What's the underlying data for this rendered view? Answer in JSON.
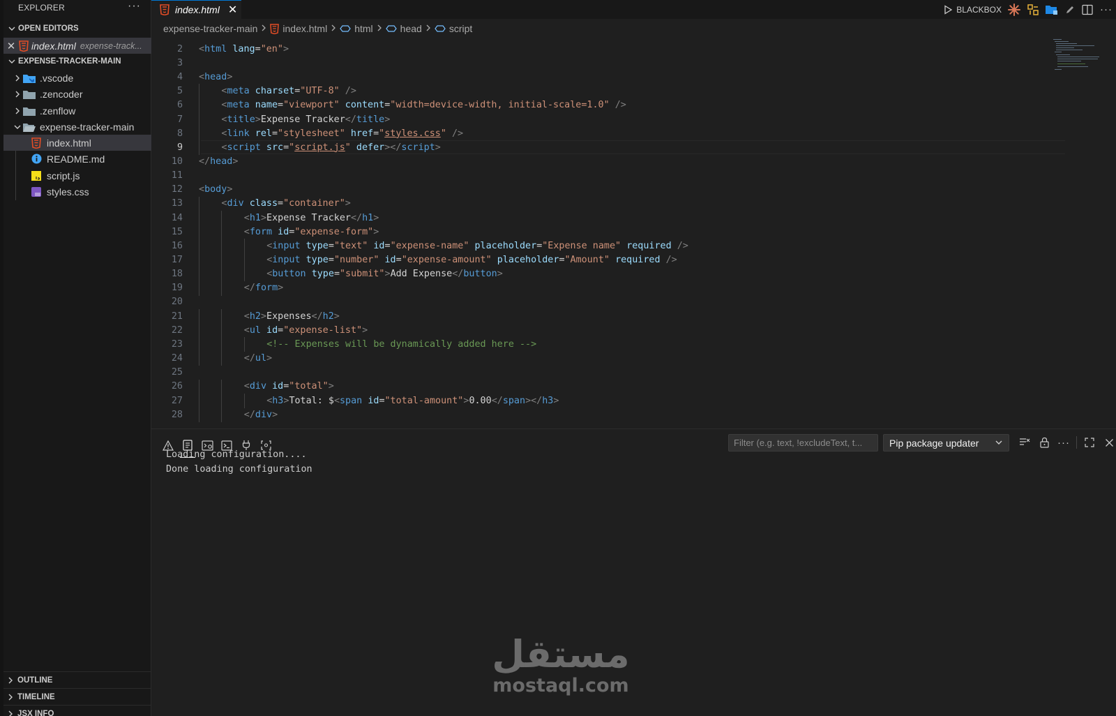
{
  "colors": {
    "html_icon": "#e44d26",
    "accent": "#0078d4",
    "folder_vscode": "#42a5f5",
    "folder_default": "#90a4ae",
    "readme_icon": "#42a5f5",
    "js_icon": "#f5de19",
    "css_icon": "#7e57c2"
  },
  "sidebar": {
    "title": "EXPLORER",
    "more": "···",
    "open_editors": {
      "label": "OPEN EDITORS",
      "item": {
        "name": "index.html",
        "description": "expense-track..."
      }
    },
    "project": {
      "label": "EXPENSE-TRACKER-MAIN",
      "items": [
        {
          "label": ".vscode",
          "icon": "vscode-folder-icon",
          "kind": "folder",
          "expanded": false
        },
        {
          "label": ".zencoder",
          "icon": "folder-icon",
          "kind": "folder",
          "expanded": false
        },
        {
          "label": ".zenflow",
          "icon": "folder-icon",
          "kind": "folder",
          "expanded": false
        },
        {
          "label": "expense-tracker-main",
          "icon": "folder-open-icon",
          "kind": "folder",
          "expanded": true
        },
        {
          "label": "index.html",
          "icon": "html-file-icon",
          "kind": "file",
          "selected": true
        },
        {
          "label": "README.md",
          "icon": "info-file-icon",
          "kind": "file"
        },
        {
          "label": "script.js",
          "icon": "js-file-icon",
          "kind": "file"
        },
        {
          "label": "styles.css",
          "icon": "css-file-icon",
          "kind": "file"
        }
      ]
    },
    "bottom_sections": [
      "OUTLINE",
      "TIMELINE",
      "JSX INFO"
    ]
  },
  "tabs": [
    {
      "label": "index.html",
      "icon": "html-file-icon",
      "active": true
    }
  ],
  "title_actions": {
    "blackbox_label": "BLACKBOX",
    "icons": [
      "run-icon",
      "claude-icon",
      "extension-icon",
      "folder-sync-icon",
      "pen-icon",
      "split-editor-icon",
      "more-icon"
    ]
  },
  "breadcrumb": {
    "items": [
      "expense-tracker-main",
      "index.html",
      "html",
      "head",
      "script"
    ]
  },
  "editor": {
    "current_line": 9,
    "lines": [
      {
        "n": "2",
        "indent": 0,
        "tokens": [
          [
            "br",
            "<"
          ],
          [
            "tag",
            "html"
          ],
          [
            "tx",
            " "
          ],
          [
            "at",
            "lang"
          ],
          [
            "tx",
            "="
          ],
          [
            "st",
            "\"en\""
          ],
          [
            "br",
            ">"
          ]
        ]
      },
      {
        "n": "3",
        "indent": 0,
        "tokens": []
      },
      {
        "n": "4",
        "indent": 0,
        "tokens": [
          [
            "br",
            "<"
          ],
          [
            "tag",
            "head"
          ],
          [
            "br",
            ">"
          ]
        ]
      },
      {
        "n": "5",
        "indent": 1,
        "tokens": [
          [
            "br",
            "<"
          ],
          [
            "tag",
            "meta"
          ],
          [
            "tx",
            " "
          ],
          [
            "at",
            "charset"
          ],
          [
            "tx",
            "="
          ],
          [
            "st",
            "\"UTF-8\""
          ],
          [
            "tx",
            " "
          ],
          [
            "br",
            "/>"
          ]
        ]
      },
      {
        "n": "6",
        "indent": 1,
        "tokens": [
          [
            "br",
            "<"
          ],
          [
            "tag",
            "meta"
          ],
          [
            "tx",
            " "
          ],
          [
            "at",
            "name"
          ],
          [
            "tx",
            "="
          ],
          [
            "st",
            "\"viewport\""
          ],
          [
            "tx",
            " "
          ],
          [
            "at",
            "content"
          ],
          [
            "tx",
            "="
          ],
          [
            "st",
            "\"width=device-width, initial-scale=1.0\""
          ],
          [
            "tx",
            " "
          ],
          [
            "br",
            "/>"
          ]
        ]
      },
      {
        "n": "7",
        "indent": 1,
        "tokens": [
          [
            "br",
            "<"
          ],
          [
            "tag",
            "title"
          ],
          [
            "br",
            ">"
          ],
          [
            "tx",
            "Expense Tracker"
          ],
          [
            "br",
            "</"
          ],
          [
            "tag",
            "title"
          ],
          [
            "br",
            ">"
          ]
        ]
      },
      {
        "n": "8",
        "indent": 1,
        "tokens": [
          [
            "br",
            "<"
          ],
          [
            "tag",
            "link"
          ],
          [
            "tx",
            " "
          ],
          [
            "at",
            "rel"
          ],
          [
            "tx",
            "="
          ],
          [
            "st",
            "\"stylesheet\""
          ],
          [
            "tx",
            " "
          ],
          [
            "at",
            "href"
          ],
          [
            "tx",
            "="
          ],
          [
            "st",
            "\""
          ],
          [
            "stu",
            "styles.css"
          ],
          [
            "st",
            "\""
          ],
          [
            "tx",
            " "
          ],
          [
            "br",
            "/>"
          ]
        ]
      },
      {
        "n": "9",
        "indent": 1,
        "tokens": [
          [
            "br",
            "<"
          ],
          [
            "tag",
            "script"
          ],
          [
            "tx",
            " "
          ],
          [
            "at",
            "src"
          ],
          [
            "tx",
            "="
          ],
          [
            "st",
            "\""
          ],
          [
            "stu",
            "script.js"
          ],
          [
            "st",
            "\""
          ],
          [
            "tx",
            " "
          ],
          [
            "at",
            "defer"
          ],
          [
            "br",
            "></"
          ],
          [
            "tag",
            "script"
          ],
          [
            "br",
            ">"
          ]
        ]
      },
      {
        "n": "10",
        "indent": 0,
        "tokens": [
          [
            "br",
            "</"
          ],
          [
            "tag",
            "head"
          ],
          [
            "br",
            ">"
          ]
        ]
      },
      {
        "n": "11",
        "indent": 0,
        "tokens": []
      },
      {
        "n": "12",
        "indent": 0,
        "tokens": [
          [
            "br",
            "<"
          ],
          [
            "tag",
            "body"
          ],
          [
            "br",
            ">"
          ]
        ]
      },
      {
        "n": "13",
        "indent": 1,
        "tokens": [
          [
            "br",
            "<"
          ],
          [
            "tag",
            "div"
          ],
          [
            "tx",
            " "
          ],
          [
            "at",
            "class"
          ],
          [
            "tx",
            "="
          ],
          [
            "st",
            "\"container\""
          ],
          [
            "br",
            ">"
          ]
        ]
      },
      {
        "n": "14",
        "indent": 2,
        "tokens": [
          [
            "br",
            "<"
          ],
          [
            "tag",
            "h1"
          ],
          [
            "br",
            ">"
          ],
          [
            "tx",
            "Expense Tracker"
          ],
          [
            "br",
            "</"
          ],
          [
            "tag",
            "h1"
          ],
          [
            "br",
            ">"
          ]
        ]
      },
      {
        "n": "15",
        "indent": 2,
        "tokens": [
          [
            "br",
            "<"
          ],
          [
            "tag",
            "form"
          ],
          [
            "tx",
            " "
          ],
          [
            "at",
            "id"
          ],
          [
            "tx",
            "="
          ],
          [
            "st",
            "\"expense-form\""
          ],
          [
            "br",
            ">"
          ]
        ]
      },
      {
        "n": "16",
        "indent": 3,
        "tokens": [
          [
            "br",
            "<"
          ],
          [
            "tag",
            "input"
          ],
          [
            "tx",
            " "
          ],
          [
            "at",
            "type"
          ],
          [
            "tx",
            "="
          ],
          [
            "st",
            "\"text\""
          ],
          [
            "tx",
            " "
          ],
          [
            "at",
            "id"
          ],
          [
            "tx",
            "="
          ],
          [
            "st",
            "\"expense-name\""
          ],
          [
            "tx",
            " "
          ],
          [
            "at",
            "placeholder"
          ],
          [
            "tx",
            "="
          ],
          [
            "st",
            "\"Expense name\""
          ],
          [
            "tx",
            " "
          ],
          [
            "at",
            "required"
          ],
          [
            "tx",
            " "
          ],
          [
            "br",
            "/>"
          ]
        ]
      },
      {
        "n": "17",
        "indent": 3,
        "tokens": [
          [
            "br",
            "<"
          ],
          [
            "tag",
            "input"
          ],
          [
            "tx",
            " "
          ],
          [
            "at",
            "type"
          ],
          [
            "tx",
            "="
          ],
          [
            "st",
            "\"number\""
          ],
          [
            "tx",
            " "
          ],
          [
            "at",
            "id"
          ],
          [
            "tx",
            "="
          ],
          [
            "st",
            "\"expense-amount\""
          ],
          [
            "tx",
            " "
          ],
          [
            "at",
            "placeholder"
          ],
          [
            "tx",
            "="
          ],
          [
            "st",
            "\"Amount\""
          ],
          [
            "tx",
            " "
          ],
          [
            "at",
            "required"
          ],
          [
            "tx",
            " "
          ],
          [
            "br",
            "/>"
          ]
        ]
      },
      {
        "n": "18",
        "indent": 3,
        "tokens": [
          [
            "br",
            "<"
          ],
          [
            "tag",
            "button"
          ],
          [
            "tx",
            " "
          ],
          [
            "at",
            "type"
          ],
          [
            "tx",
            "="
          ],
          [
            "st",
            "\"submit\""
          ],
          [
            "br",
            ">"
          ],
          [
            "tx",
            "Add Expense"
          ],
          [
            "br",
            "</"
          ],
          [
            "tag",
            "button"
          ],
          [
            "br",
            ">"
          ]
        ]
      },
      {
        "n": "19",
        "indent": 2,
        "tokens": [
          [
            "br",
            "</"
          ],
          [
            "tag",
            "form"
          ],
          [
            "br",
            ">"
          ]
        ]
      },
      {
        "n": "20",
        "indent": 0,
        "tokens": []
      },
      {
        "n": "21",
        "indent": 2,
        "tokens": [
          [
            "br",
            "<"
          ],
          [
            "tag",
            "h2"
          ],
          [
            "br",
            ">"
          ],
          [
            "tx",
            "Expenses"
          ],
          [
            "br",
            "</"
          ],
          [
            "tag",
            "h2"
          ],
          [
            "br",
            ">"
          ]
        ]
      },
      {
        "n": "22",
        "indent": 2,
        "tokens": [
          [
            "br",
            "<"
          ],
          [
            "tag",
            "ul"
          ],
          [
            "tx",
            " "
          ],
          [
            "at",
            "id"
          ],
          [
            "tx",
            "="
          ],
          [
            "st",
            "\"expense-list\""
          ],
          [
            "br",
            ">"
          ]
        ]
      },
      {
        "n": "23",
        "indent": 3,
        "tokens": [
          [
            "cm",
            "<!-- Expenses will be dynamically added here -->"
          ]
        ]
      },
      {
        "n": "24",
        "indent": 2,
        "tokens": [
          [
            "br",
            "</"
          ],
          [
            "tag",
            "ul"
          ],
          [
            "br",
            ">"
          ]
        ]
      },
      {
        "n": "25",
        "indent": 0,
        "tokens": []
      },
      {
        "n": "26",
        "indent": 2,
        "tokens": [
          [
            "br",
            "<"
          ],
          [
            "tag",
            "div"
          ],
          [
            "tx",
            " "
          ],
          [
            "at",
            "id"
          ],
          [
            "tx",
            "="
          ],
          [
            "st",
            "\"total\""
          ],
          [
            "br",
            ">"
          ]
        ]
      },
      {
        "n": "27",
        "indent": 3,
        "tokens": [
          [
            "br",
            "<"
          ],
          [
            "tag",
            "h3"
          ],
          [
            "br",
            ">"
          ],
          [
            "tx",
            "Total: $"
          ],
          [
            "br",
            "<"
          ],
          [
            "tag",
            "span"
          ],
          [
            "tx",
            " "
          ],
          [
            "at",
            "id"
          ],
          [
            "tx",
            "="
          ],
          [
            "st",
            "\"total-amount\""
          ],
          [
            "br",
            ">"
          ],
          [
            "tx",
            "0.00"
          ],
          [
            "br",
            "</"
          ],
          [
            "tag",
            "span"
          ],
          [
            "br",
            "></"
          ],
          [
            "tag",
            "h3"
          ],
          [
            "br",
            ">"
          ]
        ]
      },
      {
        "n": "28",
        "indent": 2,
        "tokens": [
          [
            "br",
            "</"
          ],
          [
            "tag",
            "div"
          ],
          [
            "br",
            ">"
          ]
        ]
      }
    ]
  },
  "panel": {
    "tab_icons": [
      "problems-icon",
      "output-icon",
      "debug-console-icon",
      "terminal-icon",
      "ports-icon",
      "gitlens-icon"
    ],
    "active_tab": "output-icon",
    "filter_placeholder": "Filter (e.g. text, !excludeText, t...",
    "channel": "Pip package updater",
    "output_lines": [
      "Loading configuration....",
      "Done loading configuration"
    ],
    "action_icons": [
      "clear-output-icon",
      "lock-scroll-icon",
      "more-icon",
      "maximize-icon",
      "close-icon"
    ]
  },
  "watermark": {
    "arabic": "مستقل",
    "latin": "mostaql.com"
  }
}
